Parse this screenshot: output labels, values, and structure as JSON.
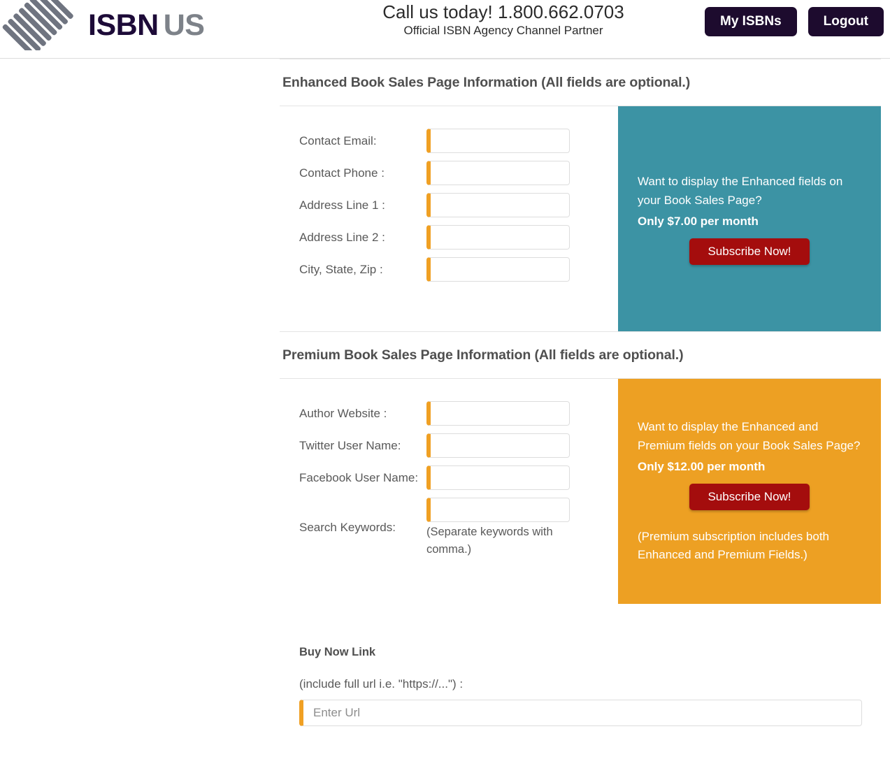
{
  "header": {
    "logo": {
      "icon": "isbnus-diamond-logo",
      "word_primary": "ISBN",
      "word_secondary": "US",
      "color_primary": "#1d0b38",
      "color_secondary": "#7d8289"
    },
    "contact_line1": "Call us today! 1.800.662.0703",
    "contact_line2": "Official ISBN Agency Channel Partner",
    "my_isbns_label": "My ISBNs",
    "logout_label": "Logout",
    "button_color": "#1d0b2e"
  },
  "enhanced": {
    "heading": "Enhanced Book Sales Page Information (All fields are optional.)",
    "fields": [
      {
        "label": "Contact Email:",
        "value": "",
        "placeholder": ""
      },
      {
        "label": "Contact Phone :",
        "value": "",
        "placeholder": ""
      },
      {
        "label": "Address Line 1 :",
        "value": "",
        "placeholder": ""
      },
      {
        "label": "Address Line 2 :",
        "value": "",
        "placeholder": ""
      },
      {
        "label": "City, State, Zip :",
        "value": "",
        "placeholder": ""
      }
    ],
    "promo": {
      "question": "Want to display the Enhanced fields on your Book Sales Page?",
      "price": "Only $7.00 per month",
      "button_label": "Subscribe Now!",
      "background_color": "#3c93a4",
      "button_color": "#a40d0d"
    }
  },
  "premium": {
    "heading": "Premium Book Sales Page Information (All fields are optional.)",
    "fields": [
      {
        "label": "Author Website :",
        "value": "",
        "placeholder": ""
      },
      {
        "label": "Twitter User Name:",
        "value": "",
        "placeholder": ""
      },
      {
        "label": "Facebook User Name:",
        "value": "",
        "placeholder": ""
      },
      {
        "label": "Search Keywords:",
        "value": "",
        "placeholder": ""
      }
    ],
    "keywords_hint": "(Separate keywords with comma.)",
    "promo": {
      "question": "Want to display the Enhanced and Premium fields on your Book Sales Page?",
      "price": "Only $12.00 per month",
      "button_label": "Subscribe Now!",
      "note": "(Premium subscription includes both Enhanced and Premium Fields.)",
      "background_color": "#eda023",
      "button_color": "#a40d0d"
    }
  },
  "buy_now": {
    "title": "Buy Now Link",
    "subtitle": "(include full url i.e. \"https://...\") :",
    "input_value": "",
    "input_placeholder": "Enter Url"
  },
  "theme": {
    "input_accent": "#f0a023",
    "text_muted": "#595959",
    "heading_color": "#4f4f4f"
  }
}
